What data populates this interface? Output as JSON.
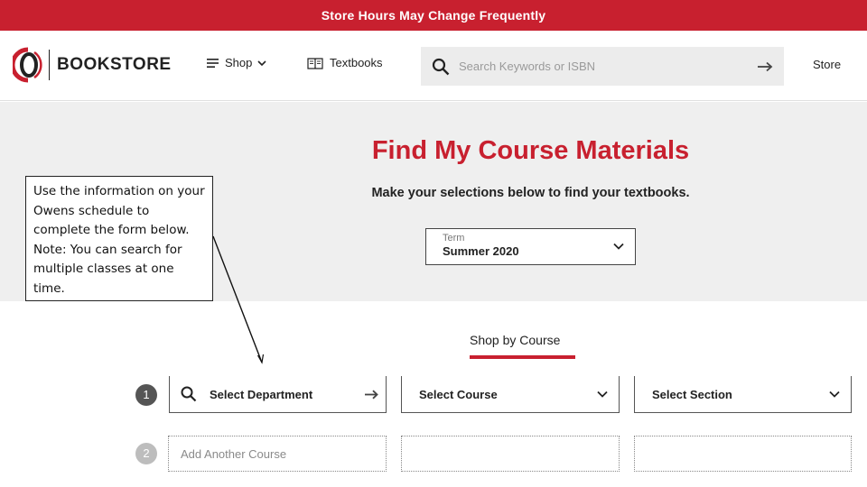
{
  "banner": {
    "text": "Store Hours May Change Frequently"
  },
  "header": {
    "logo_text": "BOOKSTORE",
    "nav": {
      "shop": "Shop",
      "textbooks": "Textbooks",
      "store": "Store"
    },
    "search": {
      "placeholder": "Search Keywords or ISBN",
      "value": ""
    }
  },
  "main": {
    "title": "Find My Course Materials",
    "subtitle": "Make your selections below to find your textbooks.",
    "term": {
      "label": "Term",
      "value": "Summer 2020"
    },
    "tab": "Shop by Course",
    "rows": [
      {
        "number": "1",
        "department": "Select Department",
        "course": "Select Course",
        "section": "Select Section"
      },
      {
        "number": "2",
        "add_placeholder": "Add Another Course"
      }
    ]
  },
  "callout": {
    "text": "Use the information on your Owens schedule to complete the form below. Note: You can search for multiple classes at one time."
  },
  "colors": {
    "brand_red": "#c8202f",
    "gray_bg": "#efefef",
    "search_bg": "#ececec"
  },
  "icons": [
    "menu-icon",
    "chevron-down-icon",
    "book-icon",
    "search-icon",
    "arrow-right-icon",
    "logo-icon"
  ]
}
